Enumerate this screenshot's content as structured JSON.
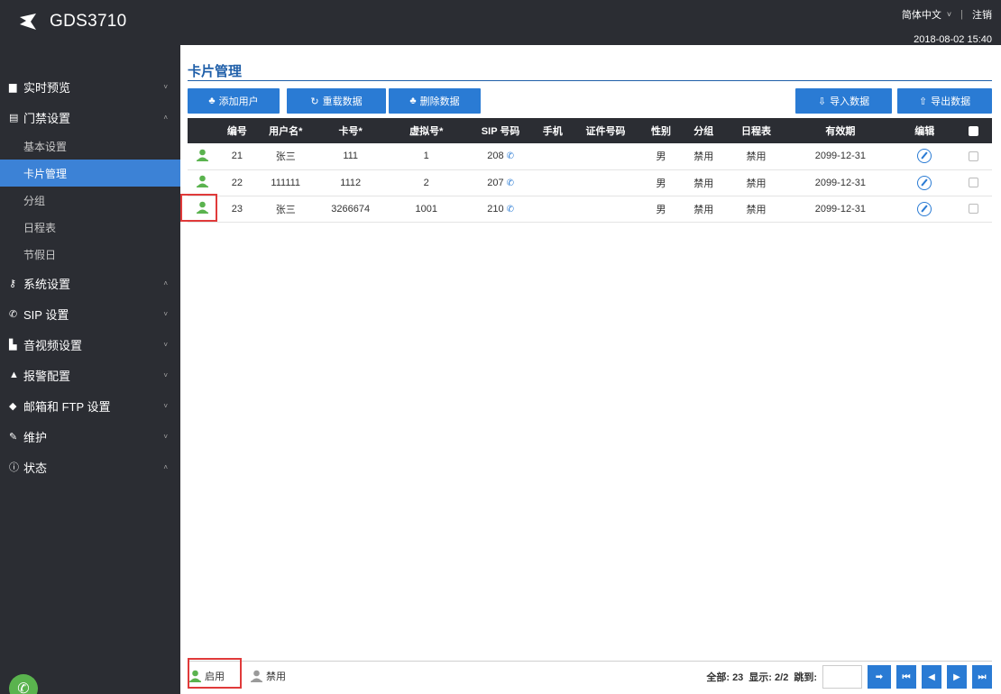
{
  "header": {
    "app_title": "GDS3710",
    "language": "简体中文",
    "logout": "注销",
    "datetime": "2018-08-02 15:40"
  },
  "sidebar": {
    "items": [
      {
        "label": "实时预览",
        "icon": "monitor-icon",
        "caret": "˅"
      },
      {
        "label": "门禁设置",
        "icon": "door-icon",
        "caret": "˄"
      },
      {
        "label": "系统设置",
        "icon": "key-icon",
        "caret": "˄"
      },
      {
        "label": "SIP 设置",
        "icon": "phone-icon",
        "caret": "˅"
      },
      {
        "label": "音视频设置",
        "icon": "video-icon",
        "caret": "˅"
      },
      {
        "label": "报警配置",
        "icon": "bell-icon",
        "caret": "˅"
      },
      {
        "label": "邮箱和 FTP 设置",
        "icon": "cloud-icon",
        "caret": "˅"
      },
      {
        "label": "维护",
        "icon": "wrench-icon",
        "caret": "˅"
      },
      {
        "label": "状态",
        "icon": "info-icon",
        "caret": "˄"
      }
    ],
    "door_sub": [
      "基本设置",
      "卡片管理",
      "分组",
      "日程表",
      "节假日"
    ],
    "active_sub": "卡片管理"
  },
  "main": {
    "title": "卡片管理",
    "buttons": {
      "add_user": "添加用户",
      "reload": "重载数据",
      "delete": "删除数据",
      "import": "导入数据",
      "export": "导出数据"
    },
    "columns": [
      "编号",
      "用户名*",
      "卡号*",
      "虚拟号*",
      "SIP 号码",
      "手机",
      "证件号码",
      "性别",
      "分组",
      "日程表",
      "有效期",
      "编辑"
    ],
    "rows": [
      {
        "id": "21",
        "name": "张三",
        "card": "111",
        "virtual": "1",
        "sip": "208",
        "mobile": "",
        "idno": "",
        "gender": "男",
        "group": "禁用",
        "schedule": "禁用",
        "expiry": "2099-12-31"
      },
      {
        "id": "22",
        "name": "111111",
        "card": "1112",
        "virtual": "2",
        "sip": "207",
        "mobile": "",
        "idno": "",
        "gender": "男",
        "group": "禁用",
        "schedule": "禁用",
        "expiry": "2099-12-31"
      },
      {
        "id": "23",
        "name": "张三",
        "card": "3266674",
        "virtual": "1001",
        "sip": "210",
        "mobile": "",
        "idno": "",
        "gender": "男",
        "group": "禁用",
        "schedule": "禁用",
        "expiry": "2099-12-31"
      }
    ]
  },
  "footer": {
    "enabled_label": "启用",
    "disabled_label": "禁用",
    "total": "全部: 23",
    "display": "显示: 2/2",
    "jump": "跳到:"
  },
  "colors": {
    "dark": "#2b2d33",
    "accent": "#2a7bd4",
    "active_sub": "#3c82d6",
    "enabled_user": "#5ab34e",
    "disabled_user": "#9a9a9a",
    "highlight": "#e03a3a"
  }
}
